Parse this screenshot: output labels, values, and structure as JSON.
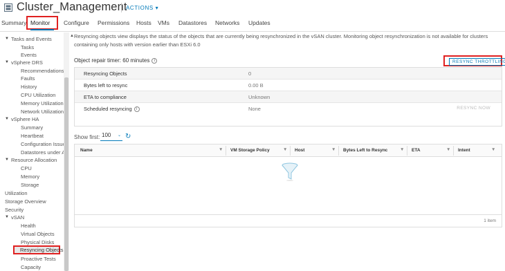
{
  "header": {
    "title": "Cluster_Management",
    "actions_label": "ACTIONS ▾"
  },
  "tabs": [
    {
      "label": "Summary",
      "active": false
    },
    {
      "label": "Monitor",
      "active": true
    },
    {
      "label": "Configure",
      "active": false
    },
    {
      "label": "Permissions",
      "active": false
    },
    {
      "label": "Hosts",
      "active": false
    },
    {
      "label": "VMs",
      "active": false
    },
    {
      "label": "Datastores",
      "active": false
    },
    {
      "label": "Networks",
      "active": false
    },
    {
      "label": "Updates",
      "active": false
    }
  ],
  "sidebar": {
    "items": [
      {
        "label": "Tasks and Events",
        "level": 0,
        "expanded": true
      },
      {
        "label": "Tasks",
        "level": 1
      },
      {
        "label": "Events",
        "level": 1
      },
      {
        "label": "vSphere DRS",
        "level": 0,
        "expanded": true
      },
      {
        "label": "Recommendations",
        "level": 1
      },
      {
        "label": "Faults",
        "level": 1
      },
      {
        "label": "History",
        "level": 1
      },
      {
        "label": "CPU Utilization",
        "level": 1
      },
      {
        "label": "Memory Utilization",
        "level": 1
      },
      {
        "label": "Network Utilization",
        "level": 1
      },
      {
        "label": "vSphere HA",
        "level": 0,
        "expanded": true
      },
      {
        "label": "Summary",
        "level": 1
      },
      {
        "label": "Heartbeat",
        "level": 1
      },
      {
        "label": "Configuration Issues",
        "level": 1
      },
      {
        "label": "Datastores under A...",
        "level": 1
      },
      {
        "label": "Resource Allocation",
        "level": 0,
        "expanded": true
      },
      {
        "label": "CPU",
        "level": 1
      },
      {
        "label": "Memory",
        "level": 1
      },
      {
        "label": "Storage",
        "level": 1
      },
      {
        "label": "Utilization",
        "level": -1
      },
      {
        "label": "Storage Overview",
        "level": -1
      },
      {
        "label": "Security",
        "level": -1
      },
      {
        "label": "vSAN",
        "level": 0,
        "expanded": true
      },
      {
        "label": "Health",
        "level": 1
      },
      {
        "label": "Virtual Objects",
        "level": 1
      },
      {
        "label": "Physical Disks",
        "level": 1
      },
      {
        "label": "Resyncing Objects",
        "level": 1,
        "selected": true
      },
      {
        "label": "Proactive Tests",
        "level": 1
      },
      {
        "label": "Capacity",
        "level": 1
      }
    ]
  },
  "main": {
    "info_text": "Resyncing objects view displays the status of the objects that are currently being resynchronized in the vSAN cluster. Monitoring object resynchronization is not available for clusters containing only hosts with version earlier than ESXi 6.0",
    "repair_timer_label": "Object repair timer: 60 minutes",
    "resync_throttling_label": "RESYNC THROTTLING",
    "summary_rows": [
      {
        "label": "Resyncing Objects",
        "value": "0"
      },
      {
        "label": "Bytes left to resync",
        "value": "0.00 B"
      },
      {
        "label": "ETA to compliance",
        "value": "Unknown"
      },
      {
        "label": "Scheduled resyncing",
        "value": "None"
      }
    ],
    "resync_now_label": "RESYNC NOW",
    "show_first_label": "Show first:",
    "show_first_value": "100",
    "grid": {
      "columns": [
        "Name",
        "VM Storage Policy",
        "Host",
        "Bytes Left to Resync",
        "ETA",
        "Intent"
      ],
      "count_label": "1 item"
    }
  },
  "colors": {
    "accent": "#0079b8",
    "highlight": "#e02020"
  }
}
